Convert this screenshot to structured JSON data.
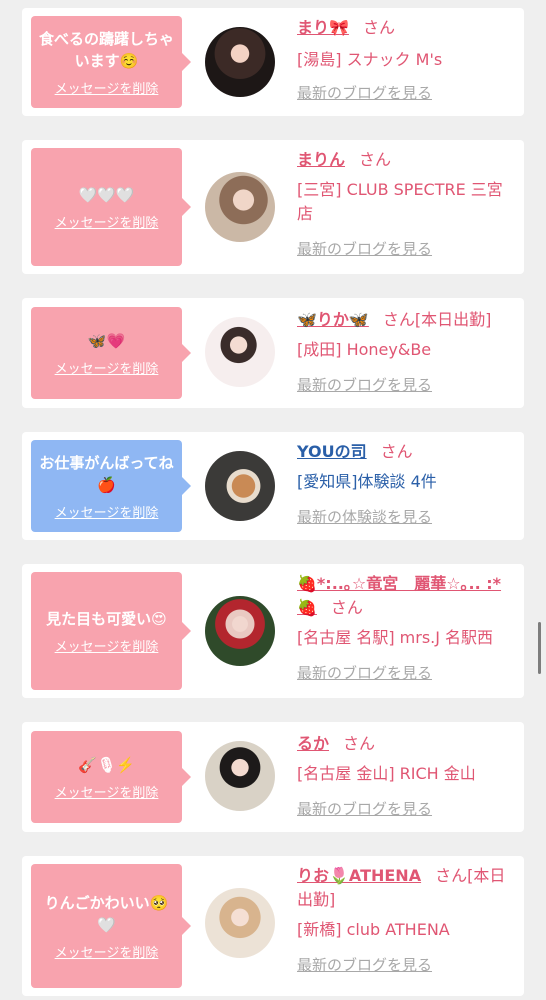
{
  "delete_label": "メッセージを削除",
  "san_label": "さん",
  "colors": {
    "pink_bubble": "#f8a3ae",
    "blue_bubble": "#8fb7f3",
    "name_pink": "#e05673",
    "name_blue": "#2a5fa8",
    "muted": "#a8a8a8"
  },
  "items": [
    {
      "message": "食べるの躊躇しちゃいます☺️",
      "name": "まり🎀",
      "status": "",
      "shop": "[湯島] スナック M's",
      "link": "最新のブログを見る",
      "bubble": "pink"
    },
    {
      "message": "🤍🤍🤍",
      "name": "まりん",
      "status": "",
      "shop": "[三宮] CLUB SPECTRE 三宮店",
      "link": "最新のブログを見る",
      "bubble": "pink"
    },
    {
      "message": "🦋💗",
      "name": "🦋りか🦋",
      "status": "[本日出勤]",
      "shop": "[成田] Honey&Be",
      "link": "最新のブログを見る",
      "bubble": "pink"
    },
    {
      "message": "お仕事がんばってね🍎",
      "name": "YOUの司",
      "status": "",
      "shop": "[愛知県]体験談 4件",
      "link": "最新の体験談を見る",
      "bubble": "blue"
    },
    {
      "message": "見た目も可愛い😍",
      "name": "🍓*:..｡☆竜宮　麗華☆｡.. :*🍓",
      "status": "",
      "shop": "[名古屋 名駅] mrs.J 名駅西",
      "link": "最新のブログを見る",
      "bubble": "pink"
    },
    {
      "message": "🎸🎙⚡️",
      "name": "るか",
      "status": "",
      "shop": "[名古屋 金山] RICH 金山",
      "link": "最新のブログを見る",
      "bubble": "pink"
    },
    {
      "message": "りんごかわいい🥺🤍",
      "name": "りお🌷ATHENA",
      "status": "[本日出勤]",
      "shop": "[新橋] club ATHENA",
      "link": "最新のブログを見る",
      "bubble": "pink"
    }
  ]
}
